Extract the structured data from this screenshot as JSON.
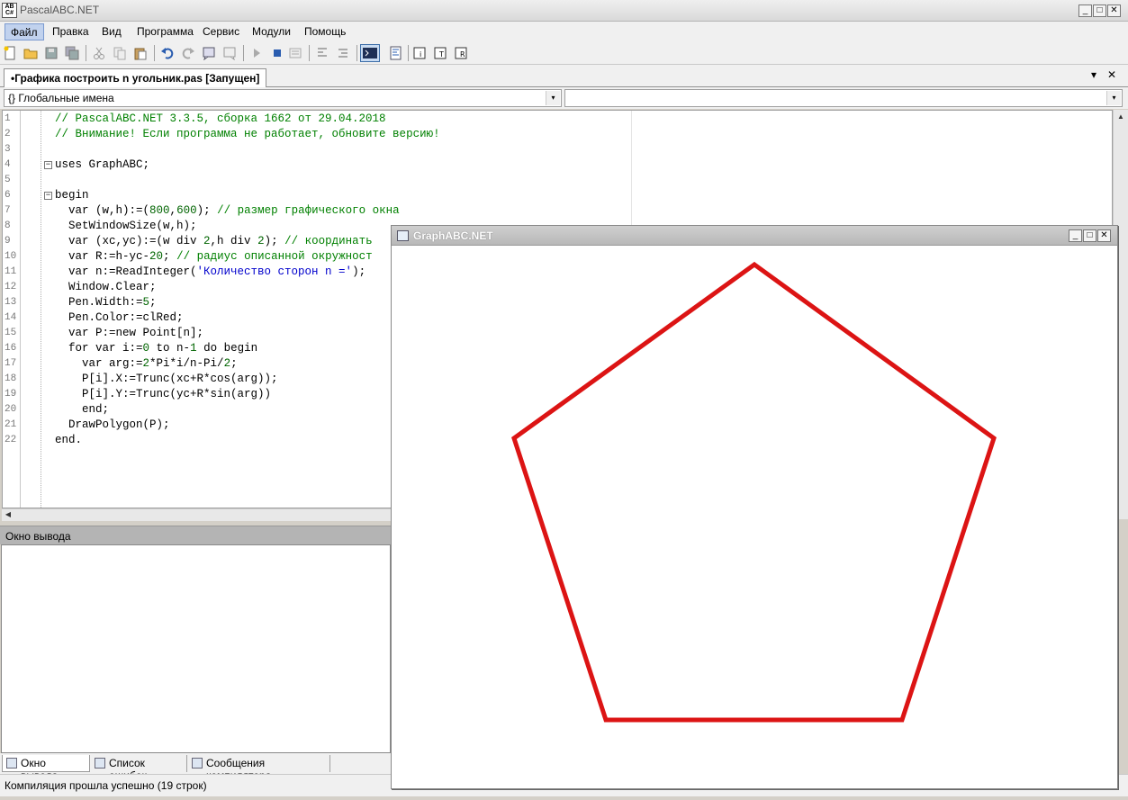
{
  "app": {
    "title": "PascalABC.NET",
    "icon_text": "AB\nC#"
  },
  "window_controls": {
    "minimize": "_",
    "maximize": "□",
    "close": "✕"
  },
  "menu": {
    "items": [
      {
        "label": "Файл",
        "active": true
      },
      {
        "label": "Правка"
      },
      {
        "label": "Вид"
      },
      {
        "label": "Программа"
      },
      {
        "label": "Сервис"
      },
      {
        "label": "Модули"
      },
      {
        "label": "Помощь"
      }
    ]
  },
  "toolbar": {
    "buttons": [
      "new-file-icon",
      "open-folder-icon",
      "save-icon",
      "save-all-icon",
      "cut-icon",
      "copy-icon",
      "paste-icon",
      "undo-icon",
      "redo-icon",
      "comment-icon",
      "uncomment-icon",
      "run-icon",
      "stop-icon",
      "debug-step-icon",
      "step-into-icon",
      "step-over-icon",
      "console-icon",
      "format-icon",
      "module-i-icon",
      "module-t-icon",
      "module-r-icon"
    ]
  },
  "tab": {
    "label": "•Графика построить n угольник.pas [Запущен]",
    "menu_arrow": "▾",
    "close": "✕"
  },
  "combos": {
    "left_value": "{} Глобальные имена",
    "right_value": "",
    "arrow": "▾"
  },
  "editor": {
    "lines": [
      {
        "n": "1",
        "fold": "",
        "parts": [
          [
            "c-comment",
            "// PascalABC.NET 3.3.5, сборка 1662 от 29.04.2018"
          ]
        ]
      },
      {
        "n": "2",
        "fold": "",
        "parts": [
          [
            "c-comment",
            "// Внимание! Если программа не работает, обновите версию!"
          ]
        ]
      },
      {
        "n": "3",
        "fold": "",
        "parts": []
      },
      {
        "n": "4",
        "fold": "⊟",
        "parts": [
          [
            "c-kw",
            "uses GraphABC;"
          ]
        ]
      },
      {
        "n": "5",
        "fold": "",
        "parts": []
      },
      {
        "n": "6",
        "fold": "⊟",
        "parts": [
          [
            "c-kw",
            "begin"
          ]
        ]
      },
      {
        "n": "7",
        "fold": "",
        "parts": [
          [
            "c-kw",
            "  var (w,h):=("
          ],
          [
            "c-num",
            "800"
          ],
          [
            "c-kw",
            ","
          ],
          [
            "c-num",
            "600"
          ],
          [
            "c-kw",
            "); "
          ],
          [
            "c-comment",
            "// размер графического окна"
          ]
        ]
      },
      {
        "n": "8",
        "fold": "",
        "parts": [
          [
            "c-kw",
            "  SetWindowSize(w,h);"
          ]
        ]
      },
      {
        "n": "9",
        "fold": "",
        "parts": [
          [
            "c-kw",
            "  var (xc,yc):=(w div "
          ],
          [
            "c-num",
            "2"
          ],
          [
            "c-kw",
            ",h div "
          ],
          [
            "c-num",
            "2"
          ],
          [
            "c-kw",
            "); "
          ],
          [
            "c-comment",
            "// координать"
          ]
        ]
      },
      {
        "n": "10",
        "fold": "",
        "parts": [
          [
            "c-kw",
            "  var R:=h-yc-"
          ],
          [
            "c-num",
            "20"
          ],
          [
            "c-kw",
            "; "
          ],
          [
            "c-comment",
            "// радиус описанной окружност"
          ]
        ]
      },
      {
        "n": "11",
        "fold": "",
        "parts": [
          [
            "c-kw",
            "  var n:=ReadInteger("
          ],
          [
            "c-str",
            "'Количество сторон n ='"
          ],
          [
            "c-kw",
            ");"
          ]
        ]
      },
      {
        "n": "12",
        "fold": "",
        "parts": [
          [
            "c-kw",
            "  Window.Clear;"
          ]
        ]
      },
      {
        "n": "13",
        "fold": "",
        "parts": [
          [
            "c-kw",
            "  Pen.Width:="
          ],
          [
            "c-num",
            "5"
          ],
          [
            "c-kw",
            ";"
          ]
        ]
      },
      {
        "n": "14",
        "fold": "",
        "parts": [
          [
            "c-kw",
            "  Pen.Color:=clRed;"
          ]
        ]
      },
      {
        "n": "15",
        "fold": "",
        "parts": [
          [
            "c-kw",
            "  var P:=new Point[n];"
          ]
        ]
      },
      {
        "n": "16",
        "fold": "",
        "parts": [
          [
            "c-kw",
            "  for var i:="
          ],
          [
            "c-num",
            "0"
          ],
          [
            "c-kw",
            " to n-"
          ],
          [
            "c-num",
            "1"
          ],
          [
            "c-kw",
            " do begin"
          ]
        ]
      },
      {
        "n": "17",
        "fold": "",
        "parts": [
          [
            "c-kw",
            "    var arg:="
          ],
          [
            "c-num",
            "2"
          ],
          [
            "c-kw",
            "*Pi*i/n-Pi/"
          ],
          [
            "c-num",
            "2"
          ],
          [
            "c-kw",
            ";"
          ]
        ]
      },
      {
        "n": "18",
        "fold": "",
        "parts": [
          [
            "c-kw",
            "    P[i].X:=Trunc(xc+R*cos(arg));"
          ]
        ]
      },
      {
        "n": "19",
        "fold": "",
        "parts": [
          [
            "c-kw",
            "    P[i].Y:=Trunc(yc+R*sin(arg))"
          ]
        ]
      },
      {
        "n": "20",
        "fold": "",
        "parts": [
          [
            "c-kw",
            "    end;"
          ]
        ]
      },
      {
        "n": "21",
        "fold": "",
        "parts": [
          [
            "c-kw",
            "  DrawPolygon(P);"
          ]
        ]
      },
      {
        "n": "22",
        "fold": "",
        "parts": [
          [
            "c-kw",
            "end."
          ]
        ]
      }
    ]
  },
  "output_panel": {
    "header": "Окно вывода",
    "content": ""
  },
  "bottom_tabs": [
    {
      "label": "Окно вывода",
      "selected": true
    },
    {
      "label": "Список ошибок"
    },
    {
      "label": "Сообщения компилятора"
    }
  ],
  "status": {
    "text": "Компиляция прошла успешно (19 строк)"
  },
  "graph_window": {
    "title": "GraphABC.NET",
    "window_size": [
      800,
      600
    ],
    "sides": 5,
    "pen_width": 5,
    "pen_color": "#dc1414"
  }
}
